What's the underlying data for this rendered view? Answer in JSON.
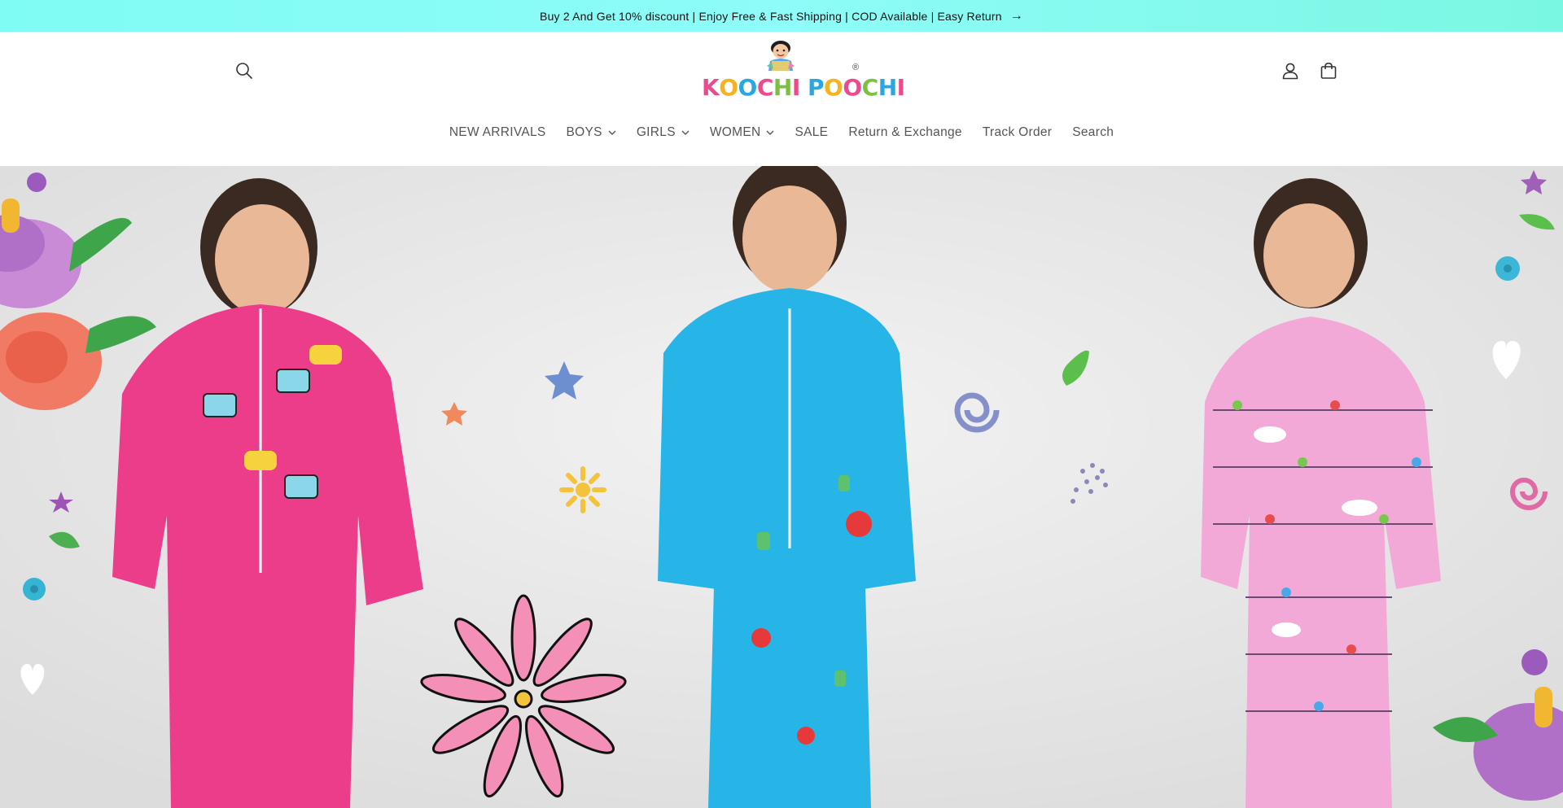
{
  "announcement": {
    "text": "Buy 2 And Get 10% discount | Enjoy Free & Fast Shipping | COD Available | Easy Return",
    "arrow": "→"
  },
  "header": {
    "logo": {
      "brand_name": "KOOCHI POOCHI",
      "registered_mark": "®"
    },
    "icons": {
      "search": "search-icon",
      "account": "user-icon",
      "cart": "bag-icon"
    }
  },
  "nav": {
    "items": [
      {
        "label": "NEW ARRIVALS",
        "has_dropdown": false
      },
      {
        "label": "BOYS",
        "has_dropdown": true
      },
      {
        "label": "GIRLS",
        "has_dropdown": true
      },
      {
        "label": "WOMEN",
        "has_dropdown": true
      },
      {
        "label": "SALE",
        "has_dropdown": false
      },
      {
        "label": "Return & Exchange",
        "has_dropdown": false
      },
      {
        "label": "Track Order",
        "has_dropdown": false
      },
      {
        "label": "Search",
        "has_dropdown": false
      }
    ]
  },
  "hero": {
    "colors": {
      "pink_pajama": "#ec3d8a",
      "blue_pajama": "#27b4e6",
      "lilac_pajama": "#f2a9d8",
      "background": "#e9e9e9"
    }
  },
  "colors": {
    "announcement_bg": "#86fbf4",
    "nav_text": "#555555",
    "logo_pink": "#ea4a8f",
    "logo_blue": "#2aa7e0"
  }
}
